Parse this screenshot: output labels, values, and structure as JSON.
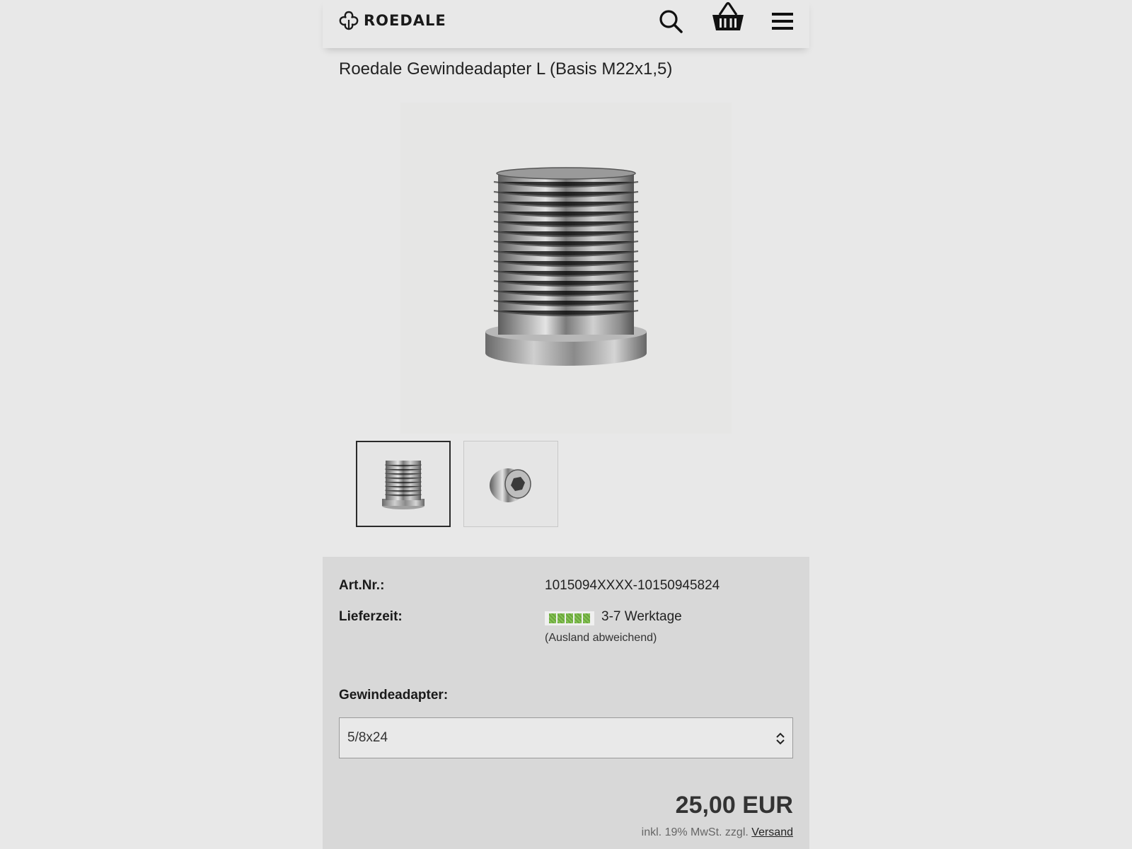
{
  "header": {
    "brand": "ROEDALE",
    "icons": [
      "logo-icon",
      "search-icon",
      "basket-icon",
      "menu-icon"
    ]
  },
  "product": {
    "title": "Roedale Gewindeadapter L (Basis M22x1,5)",
    "main_image": "threaded-adapter-image",
    "thumbnails": [
      {
        "name": "threaded-adapter-side",
        "selected": true
      },
      {
        "name": "threaded-adapter-angle",
        "selected": false
      }
    ]
  },
  "details": {
    "art_nr_label": "Art.Nr.:",
    "art_nr_value": "1015094XXXX-10150945824",
    "delivery_label": "Lieferzeit:",
    "delivery_value": "3-7 Werktage",
    "delivery_note": "(Ausland abweichend)",
    "stock_level": 1.0,
    "stock_color": "#7ab648"
  },
  "variant": {
    "label": "Gewindeadapter:",
    "selected": "5/8x24"
  },
  "pricing": {
    "price": "25,00 EUR",
    "tax_text": "inkl. 19% MwSt. zzgl.",
    "shipping_link": "Versand"
  }
}
